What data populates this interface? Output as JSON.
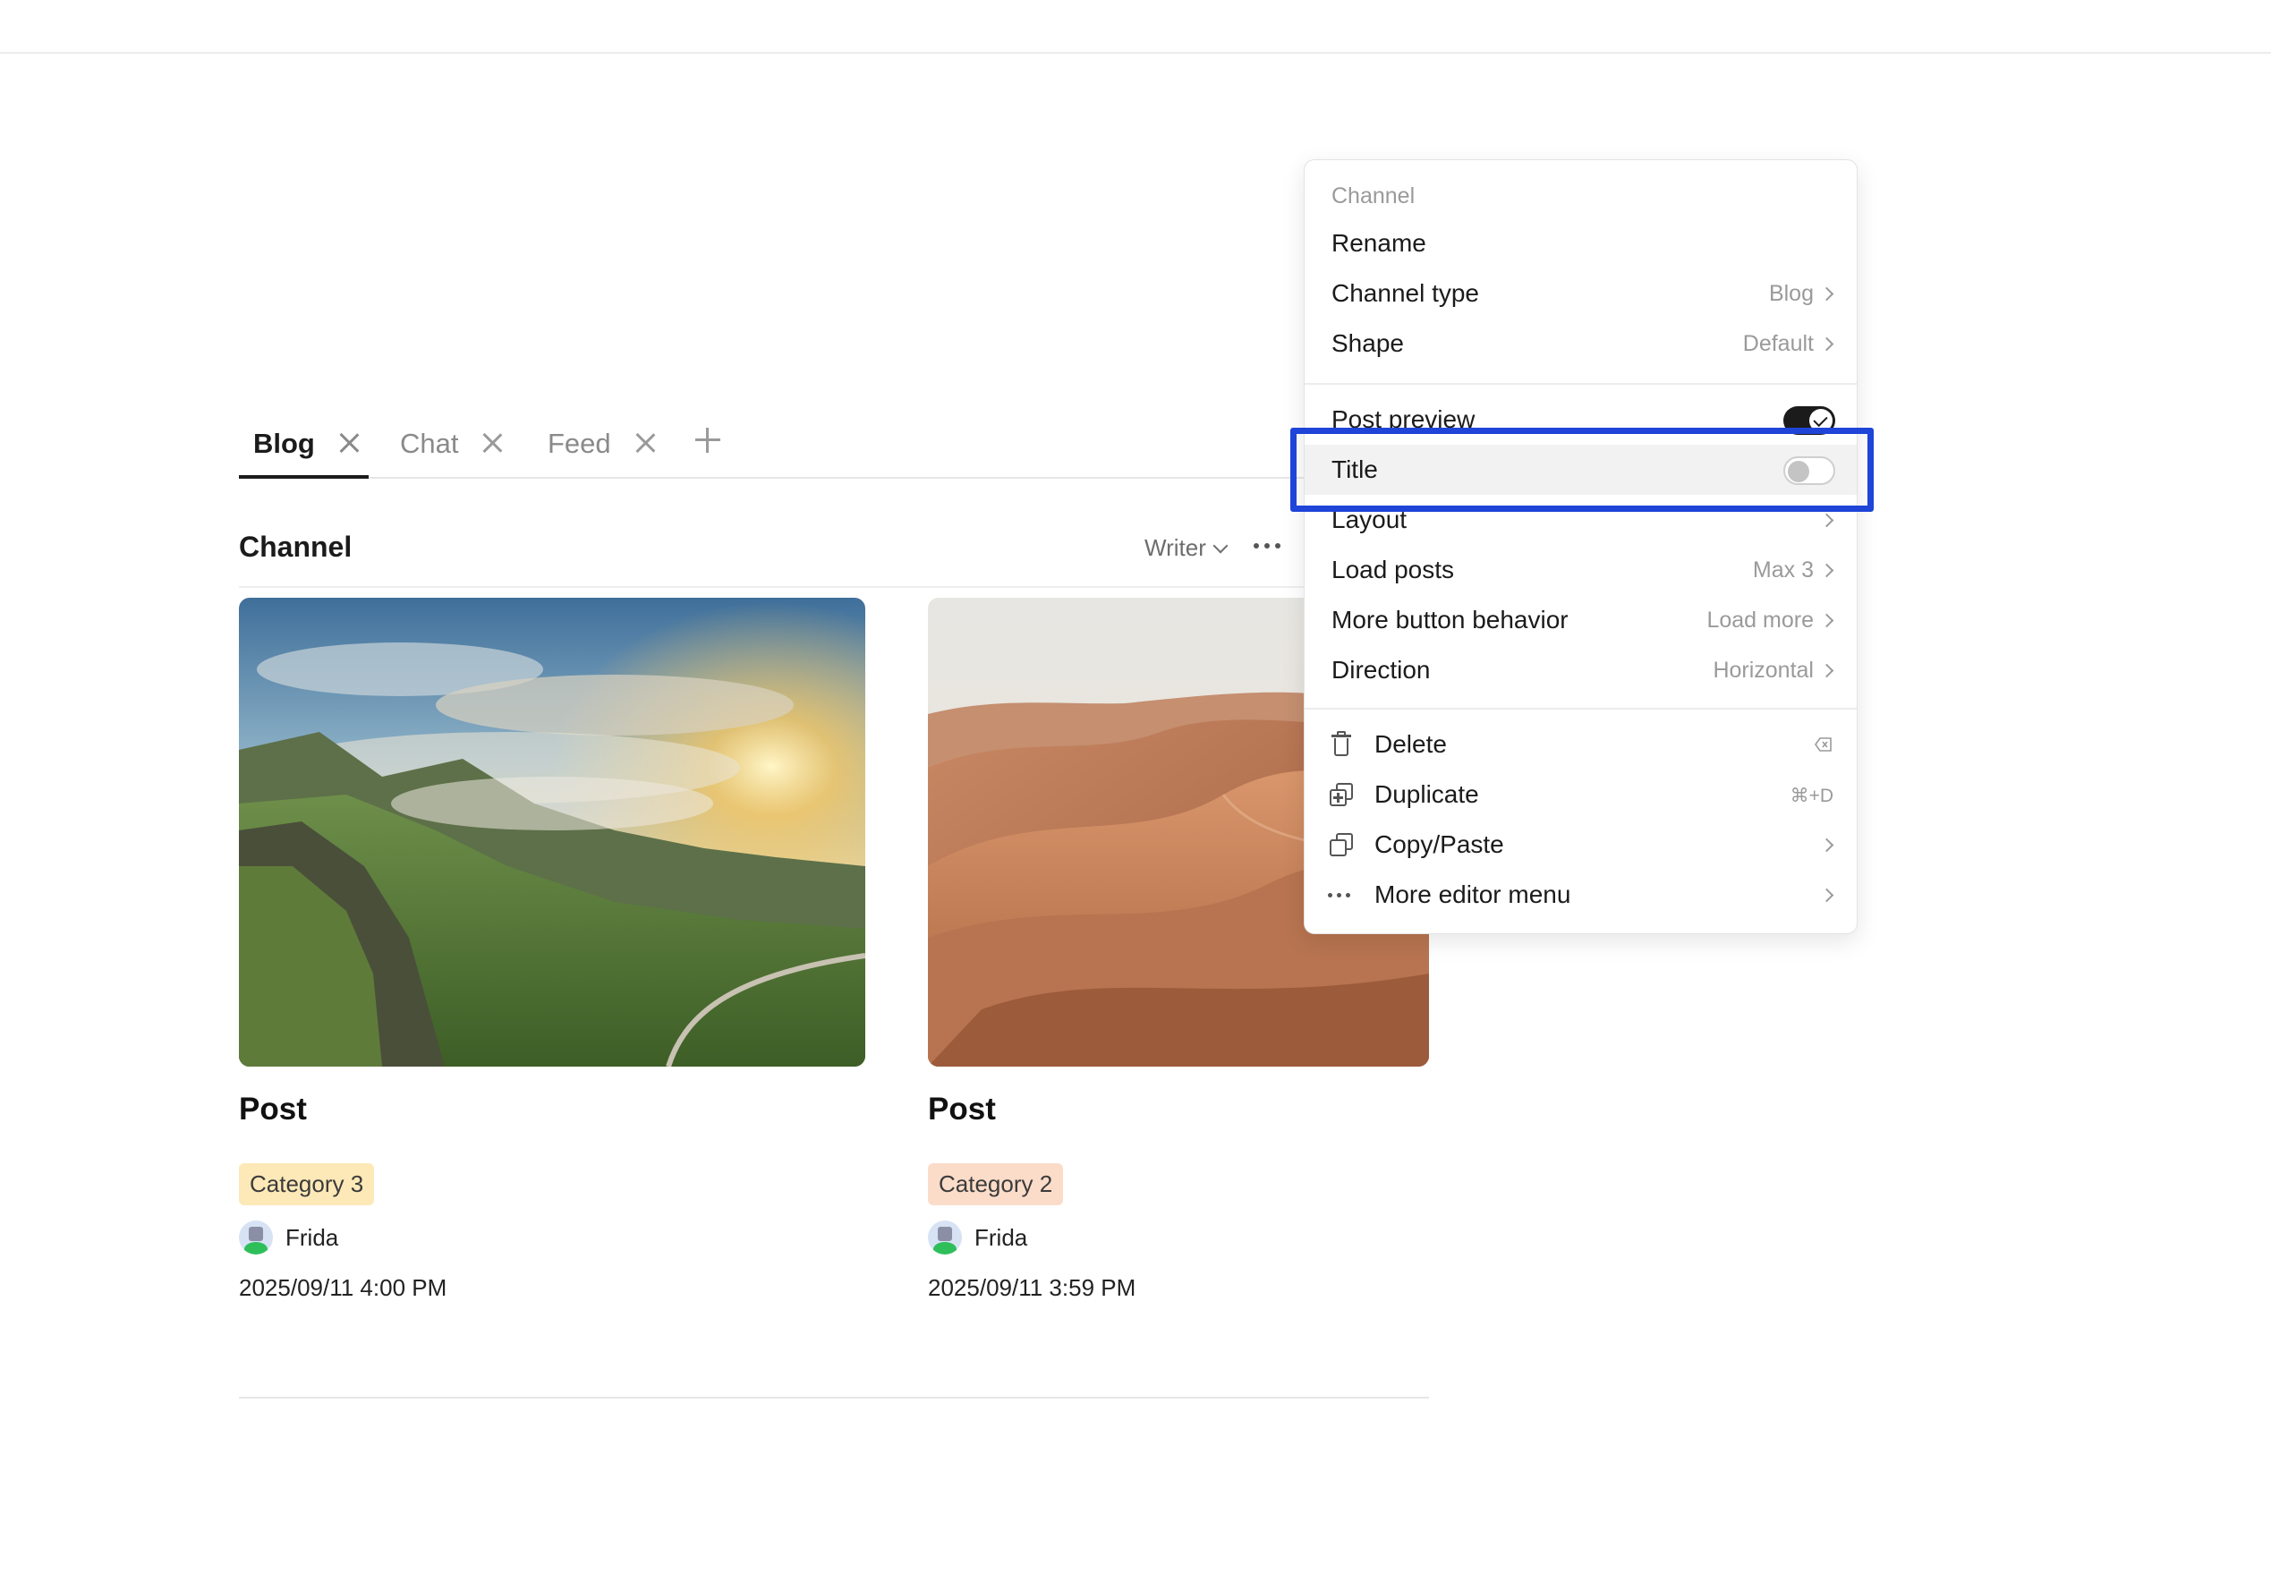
{
  "tabs": [
    {
      "label": "Blog",
      "active": true
    },
    {
      "label": "Chat",
      "active": false
    },
    {
      "label": "Feed",
      "active": false
    }
  ],
  "channel": {
    "title": "Channel",
    "writer_label": "Writer"
  },
  "posts": [
    {
      "title": "Post",
      "category": "Category 3",
      "category_color": "#fde9b7",
      "author": "Frida",
      "date": "2025/09/11 4:00 PM",
      "image": "landscape-mountains-sunset"
    },
    {
      "title": "Post",
      "category": "Category 2",
      "category_color": "#fbdcc9",
      "author": "Frida",
      "date": "2025/09/11 3:59 PM",
      "image": "desert-dunes"
    }
  ],
  "menu": {
    "section_label": "Channel",
    "rename": "Rename",
    "channel_type": {
      "label": "Channel type",
      "value": "Blog"
    },
    "shape": {
      "label": "Shape",
      "value": "Default"
    },
    "post_preview": {
      "label": "Post preview",
      "on": true
    },
    "title_toggle": {
      "label": "Title",
      "on": false
    },
    "layout": {
      "label": "Layout"
    },
    "load_posts": {
      "label": "Load posts",
      "value": "Max 3"
    },
    "more_button": {
      "label": "More button behavior",
      "value": "Load more"
    },
    "direction": {
      "label": "Direction",
      "value": "Horizontal"
    },
    "delete": {
      "label": "Delete"
    },
    "duplicate": {
      "label": "Duplicate",
      "shortcut": "⌘+D"
    },
    "copy_paste": {
      "label": "Copy/Paste"
    },
    "more_editor": {
      "label": "More editor menu"
    }
  },
  "colors": {
    "highlight": "#1e44d8",
    "toggle_on": "#1b1b1b"
  }
}
